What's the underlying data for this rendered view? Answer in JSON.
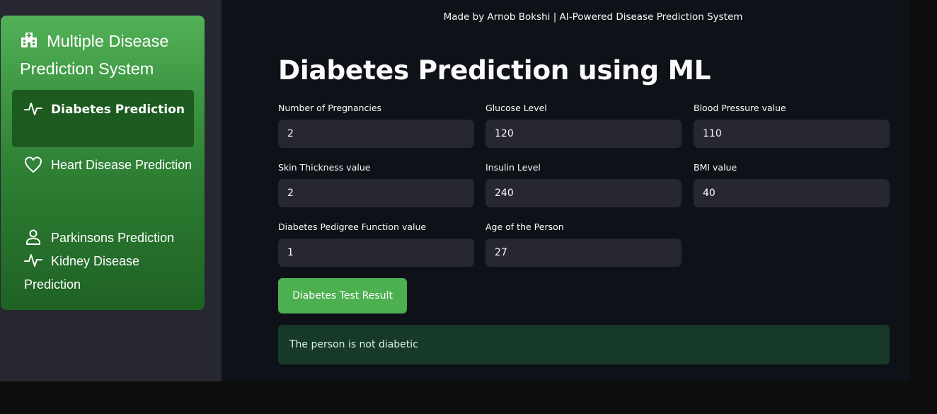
{
  "sidebar": {
    "title": "Multiple Disease Prediction System",
    "title_icon": "hospital-icon",
    "items": [
      {
        "label": "Diabetes Prediction",
        "icon": "activity-icon",
        "active": true
      },
      {
        "label": "Heart Disease Prediction",
        "icon": "heart-icon",
        "active": false
      },
      {
        "label": "Parkinsons Prediction",
        "icon": "person-icon",
        "active": false
      },
      {
        "label": "Kidney Disease Prediction",
        "icon": "activity-icon",
        "active": false
      }
    ]
  },
  "header": {
    "caption": "Made by Arnob Bokshi | AI-Powered Disease Prediction System"
  },
  "main": {
    "title": "Diabetes Prediction using ML",
    "fields": [
      {
        "label": "Number of Pregnancies",
        "value": "2"
      },
      {
        "label": "Glucose Level",
        "value": "120"
      },
      {
        "label": "Blood Pressure value",
        "value": "110"
      },
      {
        "label": "Skin Thickness value",
        "value": "2"
      },
      {
        "label": "Insulin Level",
        "value": "240"
      },
      {
        "label": "BMI value",
        "value": "40"
      },
      {
        "label": "Diabetes Pedigree Function value",
        "value": "1"
      },
      {
        "label": "Age of the Person",
        "value": "27"
      }
    ],
    "submit_label": "Diabetes Test Result",
    "result_text": "The person is not diabetic"
  },
  "colors": {
    "accent": "#4caf50",
    "sidebar_menu_active": "#1c5a20",
    "background": "#0e1117",
    "input_background": "#262730",
    "success_background": "#173928"
  }
}
